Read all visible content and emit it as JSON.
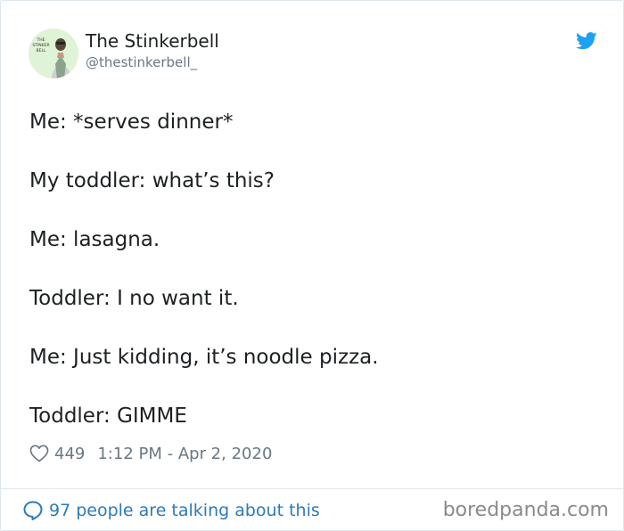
{
  "tweet": {
    "author": {
      "display_name": "The Stinkerbell",
      "handle": "@thestinkerbell_",
      "avatar_text": "THE STINKER BELL"
    },
    "lines": [
      "Me: *serves dinner*",
      "My toddler: what’s this?",
      "Me: lasagna.",
      "Toddler: I no want it.",
      "Me: Just kidding, it’s noodle pizza.",
      "Toddler: GIMME"
    ],
    "likes": "449",
    "timestamp": "1:12 PM - Apr 2, 2020"
  },
  "footer": {
    "talking_text": "97 people are talking about this",
    "watermark": "boredpanda.com"
  },
  "icons": {
    "brand": "twitter-bird-icon",
    "like": "heart-icon",
    "reply": "speech-bubble-icon"
  },
  "colors": {
    "twitter_blue": "#1da1f2",
    "link_blue": "#2b7bb9",
    "muted_gray": "#697882",
    "text": "#1c2022",
    "avatar_bg": "#dff3d6"
  }
}
